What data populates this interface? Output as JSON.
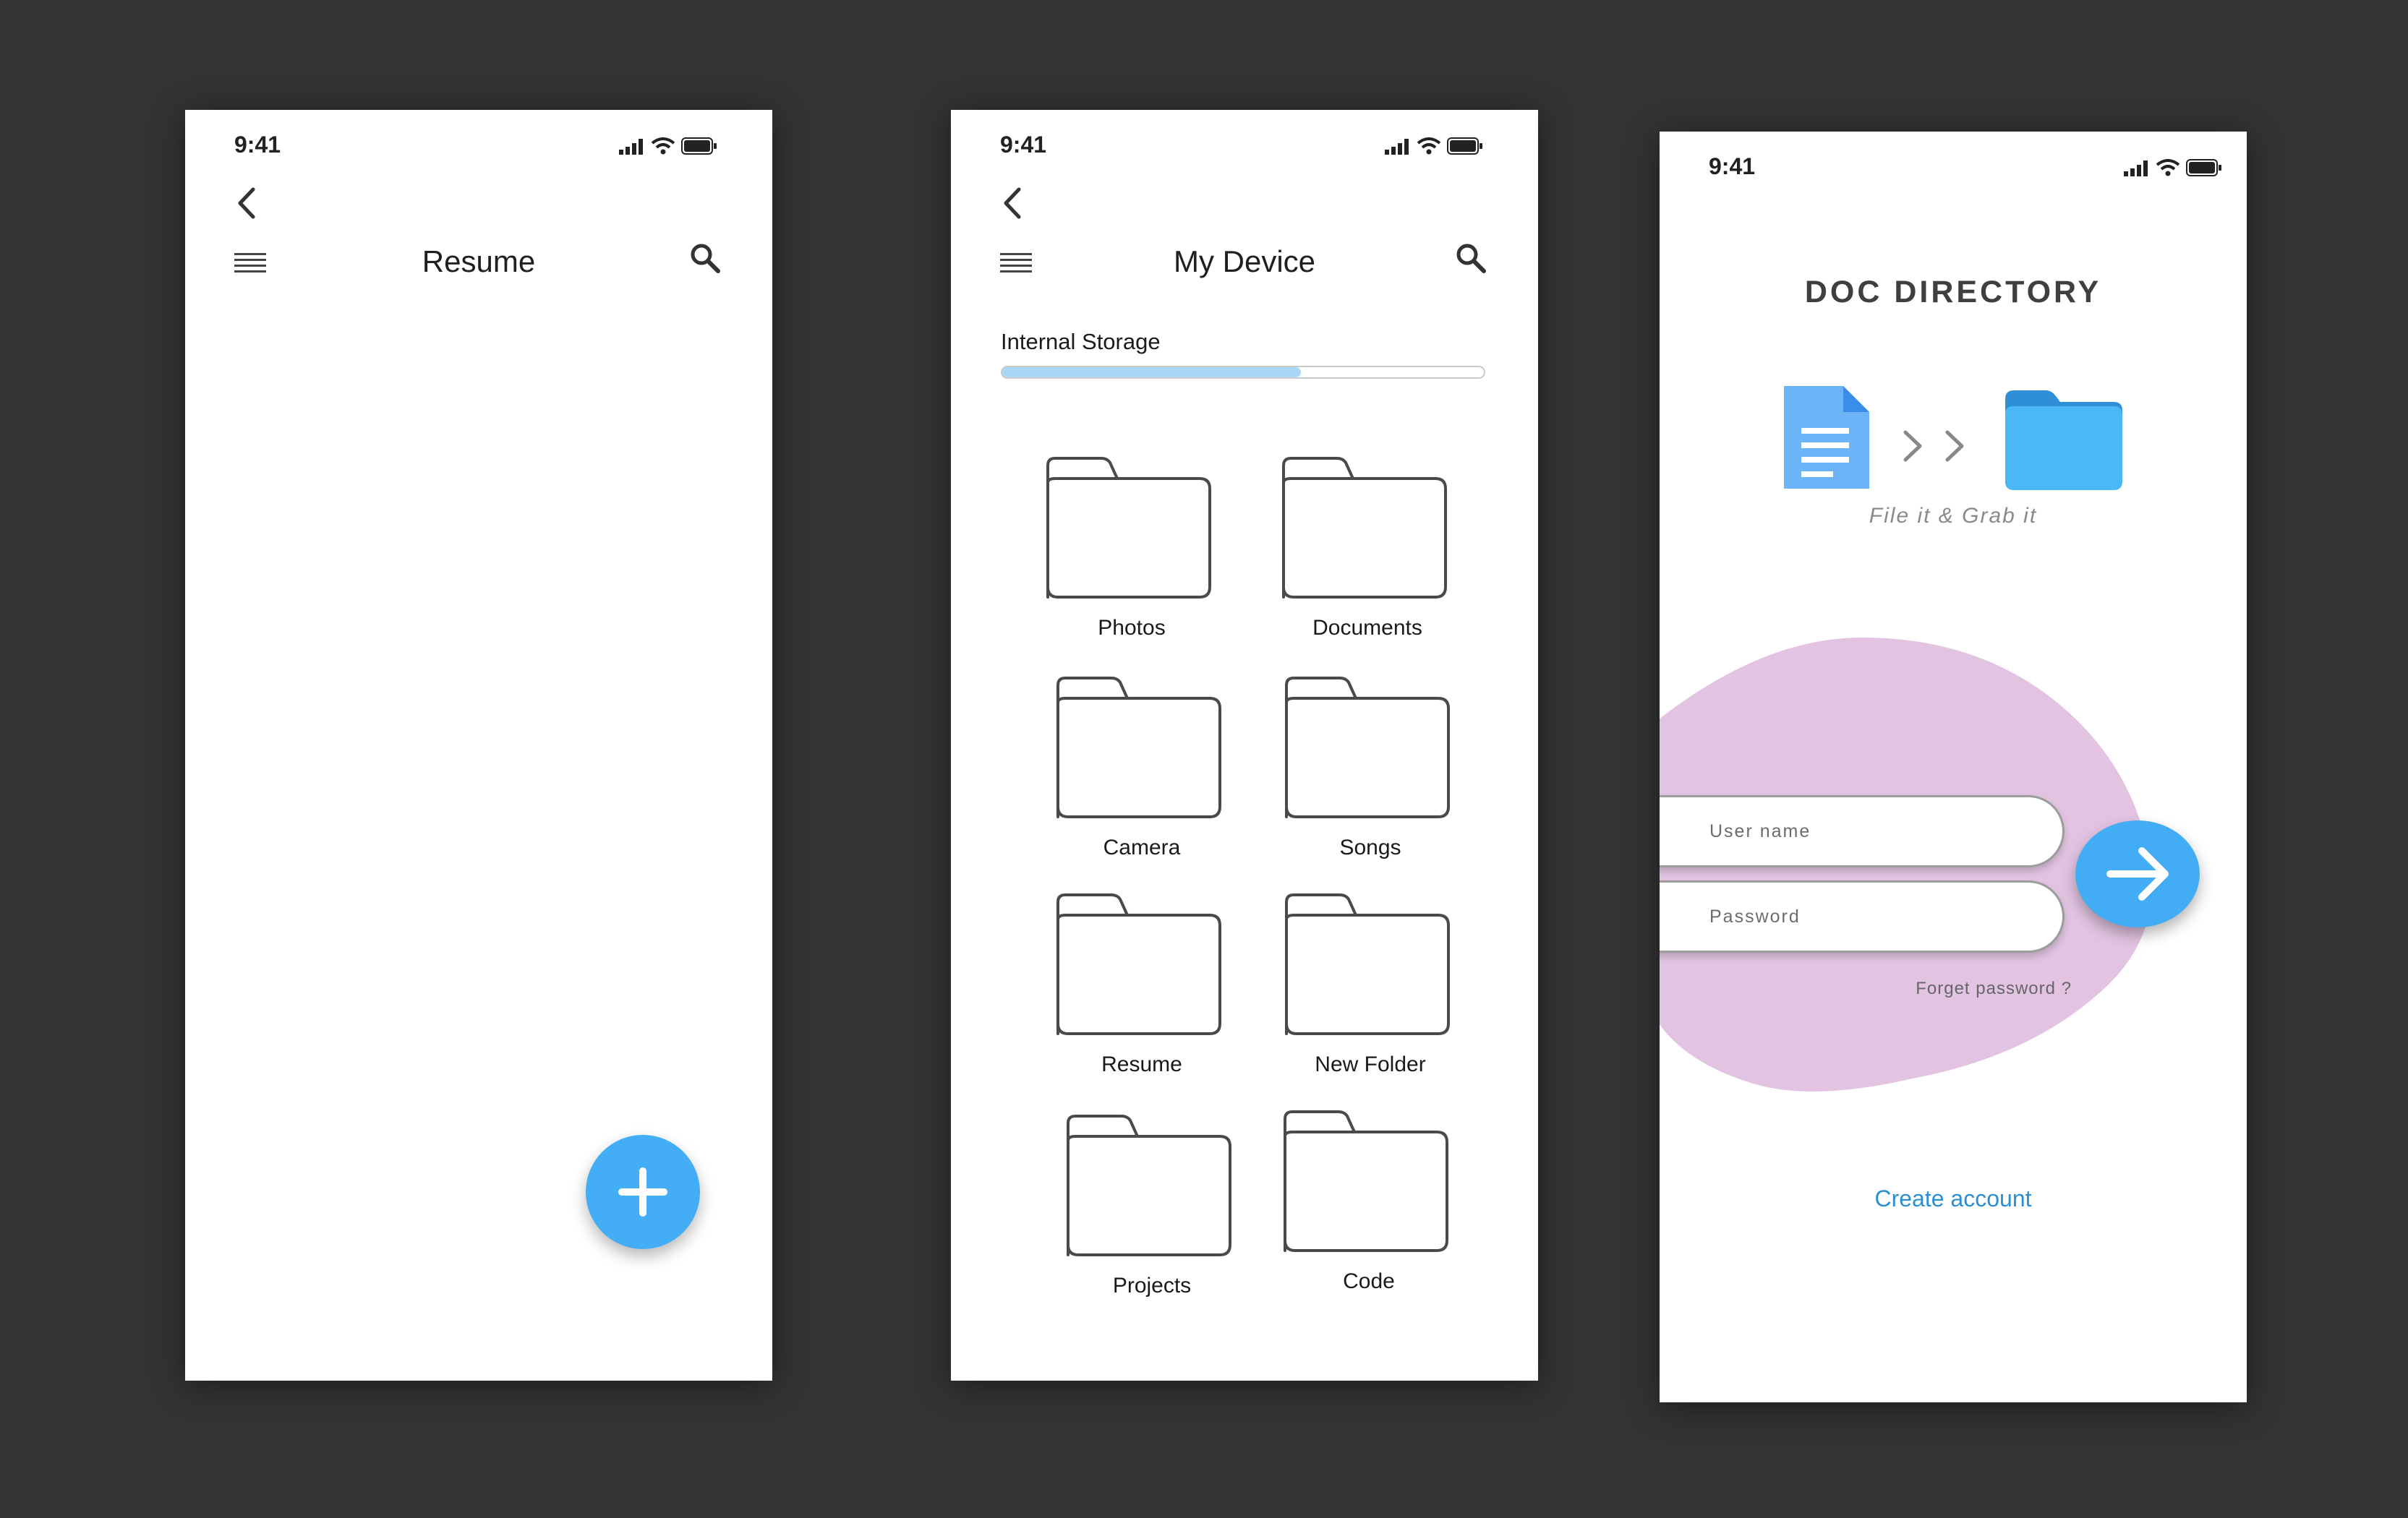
{
  "colors": {
    "accent": "#43aef5",
    "blob": "#e2c4e2",
    "link": "#2b8fd3",
    "background": "#333333"
  },
  "status_bar": {
    "time": "9:41",
    "icons": [
      "signal-icon",
      "wifi-icon",
      "battery-icon"
    ]
  },
  "resume_screen": {
    "title": "Resume",
    "icons": {
      "back": "chevron-left-icon",
      "menu": "menu-icon",
      "search": "search-icon",
      "fab": "plus-icon"
    }
  },
  "device_screen": {
    "title": "My Device",
    "storage": {
      "label": "Internal Storage",
      "used_fraction": 0.62
    },
    "folders": [
      {
        "label": "Photos"
      },
      {
        "label": "Documents"
      },
      {
        "label": "Camera"
      },
      {
        "label": "Songs"
      },
      {
        "label": "Resume"
      },
      {
        "label": "New Folder"
      },
      {
        "label": "Projects"
      },
      {
        "label": "Code"
      }
    ]
  },
  "login_screen": {
    "app_title": "DOC DIRECTORY",
    "tagline": "File it  & Grab it",
    "username_placeholder": "User name",
    "password_placeholder": "Password",
    "forget_password": "Forget password ?",
    "create_account": "Create account"
  }
}
